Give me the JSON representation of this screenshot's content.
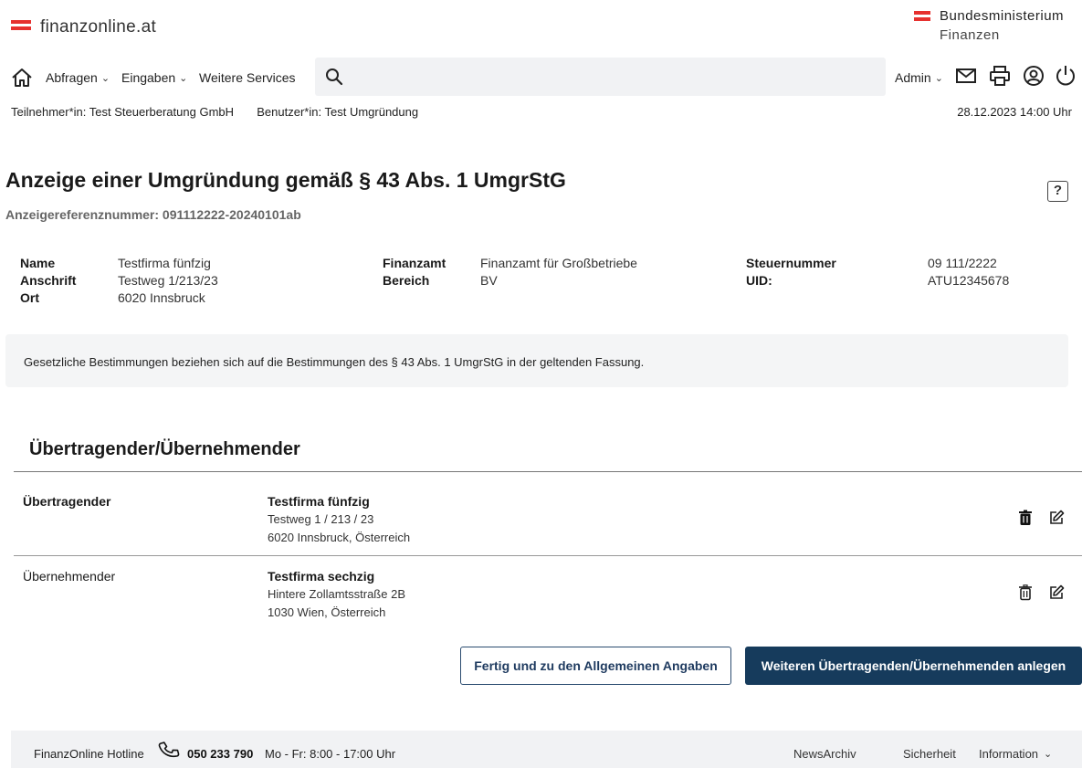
{
  "header": {
    "brand": "finanzonline.at",
    "ministry_line1": "Bundesministerium",
    "ministry_line2": "Finanzen"
  },
  "nav": {
    "home_icon": "home-icon",
    "abfragen": "Abfragen",
    "eingaben": "Eingaben",
    "weitere": "Weitere Services",
    "search_icon": "search-icon",
    "admin": "Admin",
    "icons": [
      "mail-icon",
      "print-icon",
      "user-icon",
      "power-icon"
    ]
  },
  "meta": {
    "teilnehmer_label": "Teilnehmer*in:",
    "teilnehmer_value": "Test Steuerberatung GmbH",
    "benutzer_label": "Benutzer*in:",
    "benutzer_value": "Test Umgründung",
    "datetime": "28.12.2023 14:00 Uhr"
  },
  "page": {
    "title": "Anzeige einer Umgründung gemäß § 43 Abs. 1 UmgrStG",
    "reference": "Anzeigereferenznummer: 091112222-20240101ab",
    "help": "?"
  },
  "info": {
    "name_label": "Name",
    "name_value": "Testfirma fünfzig",
    "anschrift_label": "Anschrift",
    "anschrift_value": "Testweg 1/213/23",
    "ort_label": "Ort",
    "ort_value": "6020 Innsbruck",
    "finanzamt_label": "Finanzamt",
    "finanzamt_value": "Finanzamt für Großbetriebe",
    "bereich_label": "Bereich",
    "bereich_value": "BV",
    "steuernummer_label": "Steuernummer",
    "steuernummer_value": "09 111/2222",
    "uid_label": "UID:",
    "uid_value": "ATU12345678"
  },
  "notice": "Gesetzliche Bestimmungen beziehen sich auf die Bestimmungen des § 43 Abs. 1 UmgrStG in der geltenden Fassung.",
  "section": {
    "title": "Übertragender/Übernehmender",
    "rows": [
      {
        "label": "Übertragender",
        "name": "Testfirma fünfzig",
        "addr1": "Testweg 1 / 213 / 23",
        "addr2": "6020 Innsbruck, Österreich"
      },
      {
        "label": "Übernehmender",
        "name": "Testfirma sechzig",
        "addr1": "Hintere Zollamtsstraße 2B",
        "addr2": "1030 Wien, Österreich"
      }
    ]
  },
  "buttons": {
    "fertig": "Fertig und zu den Allgemeinen Angaben",
    "weitere": "Weiteren Übertragenden/Übernehmenden anlegen"
  },
  "footer": {
    "hotline": "FinanzOnline Hotline",
    "number": "050 233 790",
    "hours": "Mo - Fr: 8:00 - 17:00 Uhr",
    "news": "NewsArchiv",
    "sicherheit": "Sicherheit",
    "information": "Information"
  },
  "colors": {
    "accent_red": "#e6312f",
    "primary_blue": "#163b5c"
  }
}
